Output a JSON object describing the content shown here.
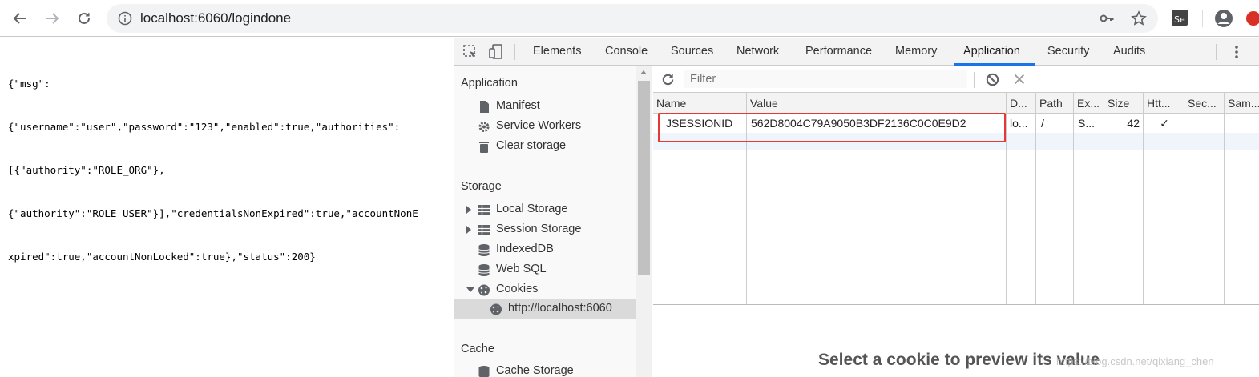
{
  "browser": {
    "url": "localhost:6060/logindone"
  },
  "page": {
    "json_lines": [
      "{\"msg\":",
      "{\"username\":\"user\",\"password\":\"123\",\"enabled\":true,\"authorities\":",
      "[{\"authority\":\"ROLE_ORG\"},",
      "{\"authority\":\"ROLE_USER\"}],\"credentialsNonExpired\":true,\"accountNonE",
      "xpired\":true,\"accountNonLocked\":true},\"status\":200}"
    ]
  },
  "devtools": {
    "tabs": [
      "Elements",
      "Console",
      "Sources",
      "Network",
      "Performance",
      "Memory",
      "Application",
      "Security",
      "Audits"
    ],
    "active_tab": "Application",
    "accent_color": "#1a73e8"
  },
  "sidebar": {
    "application_header": "Application",
    "application_items": [
      {
        "label": "Manifest",
        "icon": "file-icon"
      },
      {
        "label": "Service Workers",
        "icon": "gear-icon"
      },
      {
        "label": "Clear storage",
        "icon": "trash-icon"
      }
    ],
    "storage_header": "Storage",
    "storage_items": [
      {
        "label": "Local Storage",
        "icon": "grid-icon"
      },
      {
        "label": "Session Storage",
        "icon": "grid-icon"
      },
      {
        "label": "IndexedDB",
        "icon": "database-icon"
      },
      {
        "label": "Web SQL",
        "icon": "database-icon"
      },
      {
        "label": "Cookies",
        "icon": "cookie-icon"
      },
      {
        "label": "http://localhost:6060",
        "icon": "cookie-icon"
      }
    ],
    "cache_header": "Cache",
    "cache_items": [
      {
        "label": "Cache Storage",
        "icon": "database-icon"
      }
    ]
  },
  "cookies": {
    "filter_placeholder": "Filter",
    "columns": [
      "Name",
      "Value",
      "D...",
      "Path",
      "Ex...",
      "Size",
      "Htt...",
      "Sec...",
      "Sam..."
    ],
    "rows": [
      {
        "name": "JSESSIONID",
        "value": "562D8004C79A9050B3DF2136C0C0E9D2",
        "domain": "lo...",
        "path": "/",
        "expires": "S...",
        "size": "42",
        "http_only": "✓",
        "secure": "",
        "same_site": ""
      }
    ],
    "highlight_color": "#e53935",
    "preview_text": "Select a cookie to preview its value"
  },
  "watermark": "https://blog.csdn.net/qixiang_chen"
}
